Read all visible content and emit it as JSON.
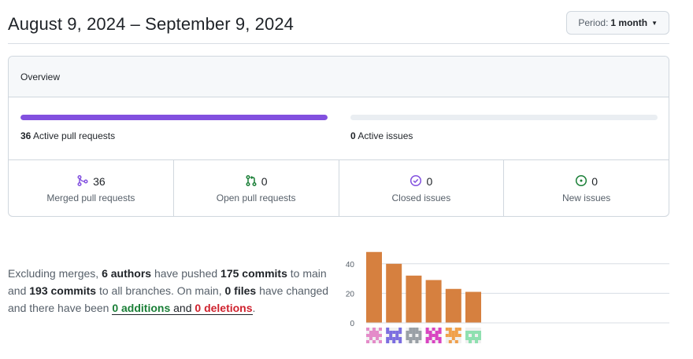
{
  "header": {
    "date_range": "August 9, 2024 – September 9, 2024",
    "period_label": "Period:",
    "period_value": "1 month"
  },
  "overview": {
    "title": "Overview",
    "pull_requests": {
      "count": "36",
      "label": "Active pull requests",
      "fill_fraction": 1.0,
      "color": "#8250df"
    },
    "issues": {
      "count": "0",
      "label": "Active issues",
      "fill_fraction": 0.0
    },
    "stats": [
      {
        "icon": "git-merge-icon",
        "value": "36",
        "label": "Merged pull requests",
        "color": "#8250df"
      },
      {
        "icon": "git-pull-request-icon",
        "value": "0",
        "label": "Open pull requests",
        "color": "#1a7f37"
      },
      {
        "icon": "issue-closed-icon",
        "value": "0",
        "label": "Closed issues",
        "color": "#8250df"
      },
      {
        "icon": "issue-opened-icon",
        "value": "0",
        "label": "New issues",
        "color": "#1a7f37"
      }
    ]
  },
  "summary": {
    "p1": "Excluding merges, ",
    "authors": "6 authors",
    "p2": " have pushed ",
    "commits_main": "175 commits",
    "p3": " to main and ",
    "commits_all": "193 commits",
    "p4": " to all branches. On main, ",
    "files": "0 files",
    "p5": " have changed and there have been ",
    "additions": "0 additions",
    "p6": " and ",
    "deletions": "0 deletions",
    "p7": "."
  },
  "chart_data": {
    "type": "bar",
    "categories": [
      "author-1",
      "author-2",
      "author-3",
      "author-4",
      "author-5",
      "author-6"
    ],
    "values": [
      48,
      40,
      32,
      29,
      23,
      21
    ],
    "ylim": [
      0,
      50
    ],
    "yticks": [
      "0",
      "20",
      "40"
    ],
    "bar_color": "#d6803f",
    "grid": true,
    "avatar_colors": [
      "#e48bc9",
      "#7c6ee0",
      "#9aa0a6",
      "#d944c1",
      "#f0a04b",
      "#8fe0b0"
    ]
  }
}
